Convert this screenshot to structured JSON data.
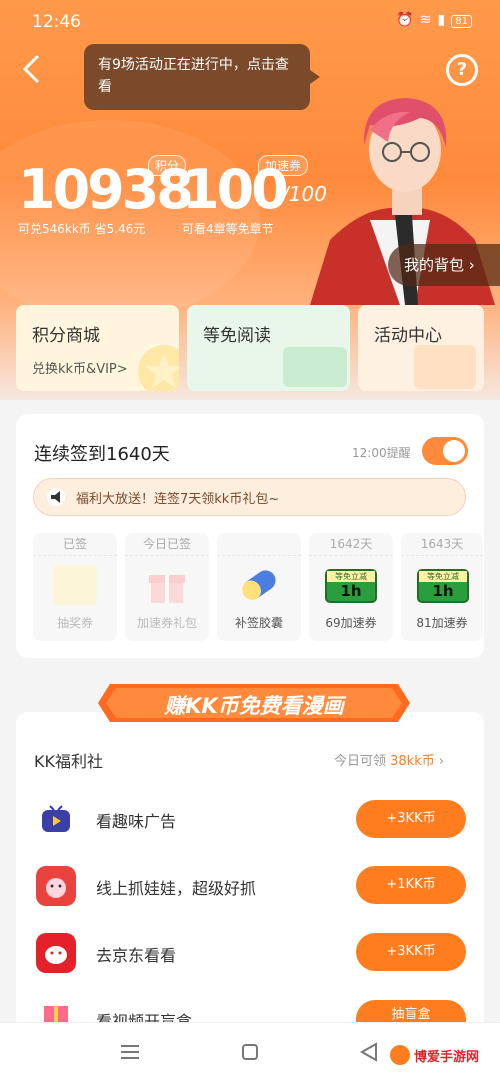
{
  "status_bar": {
    "time": "12:46",
    "battery": "81"
  },
  "tooltip": "有9场活动正在进行中，点击查看",
  "points": {
    "value": "10938",
    "tag": "积分",
    "sub": "可兑546kk币 省5.46元"
  },
  "speed": {
    "value": "100",
    "total": "/100",
    "tag": "加速券",
    "sub": "可看4章等免章节"
  },
  "bag_label": "我的背包",
  "cards": [
    {
      "title": "积分商城",
      "subtitle": "兑换kk币&VIP>"
    },
    {
      "title": "等免阅读",
      "subtitle": ""
    },
    {
      "title": "活动中心",
      "subtitle": ""
    }
  ],
  "sign_in": {
    "title": "连续签到1640天",
    "remind_label": "12:00提醒",
    "remind_on": true,
    "notice": "福利大放送！连签7天领kk币礼包~",
    "days": [
      {
        "header": "已签",
        "name": "抽奖券",
        "done": true
      },
      {
        "header": "今日已签",
        "name": "加速券礼包",
        "done": true
      },
      {
        "header": "",
        "name": "补签胶囊",
        "done": false
      },
      {
        "header": "1642天",
        "name": "69加速券",
        "done": false,
        "voucher": "1h"
      },
      {
        "header": "1643天",
        "name": "81加速券",
        "done": false,
        "voucher": "1h"
      }
    ]
  },
  "banner": "赚KK币免费看漫画",
  "welfare": {
    "title": "KK福利社",
    "today_prefix": "今日可领 ",
    "today_amount": "38kk币",
    "items": [
      {
        "label": "看趣味广告",
        "button": "+3KK币",
        "icon": "tv-icon"
      },
      {
        "label": "线上抓娃娃，超级好抓",
        "button": "+1KK币",
        "icon": "claw-machine-icon"
      },
      {
        "label": "去京东看看",
        "button": "+3KK币",
        "icon": "jd-icon"
      },
      {
        "label": "看视频开盲盒",
        "button": "抽盲盒",
        "icon": "gift-box-icon"
      }
    ]
  },
  "voucher_top": "等免立减",
  "watermark": "博爱手游网",
  "colors": {
    "accent": "#ff7d1f",
    "hero": "#ff8a3b"
  }
}
